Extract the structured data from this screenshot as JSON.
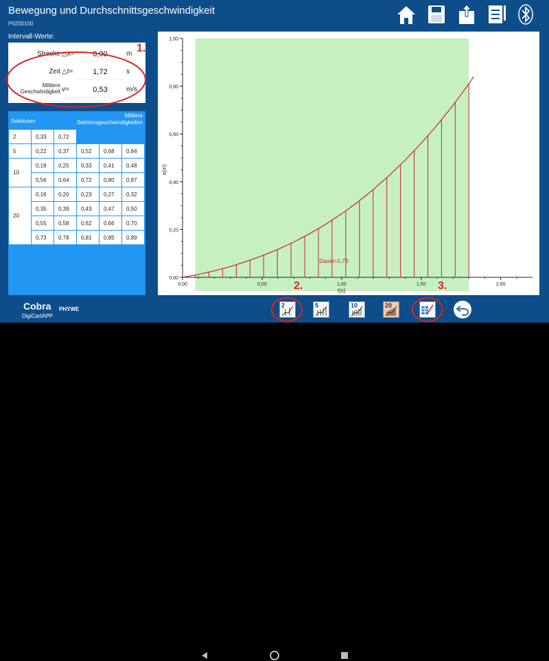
{
  "header": {
    "title": "Bewegung und Durchschnittsgeschwindigkeit",
    "subtitle": "P6200100",
    "icons": [
      "home-icon",
      "save-icon",
      "share-icon",
      "notes-icon",
      "bluetooth-icon"
    ]
  },
  "intervals": {
    "title": "Intervall-Werte:",
    "rows": [
      {
        "label": "Strecke",
        "symbol": "△x=",
        "value": "0,90",
        "unit": "m"
      },
      {
        "label": "Zeit",
        "symbol": "△t=",
        "value": "1,72",
        "unit": "s"
      },
      {
        "label": "Mittlere Geschwindigkeit",
        "symbol": "v=",
        "value": "0,53",
        "unit": "m/s"
      }
    ]
  },
  "sections": {
    "header_left": "Sektionen",
    "header_right_1": "Mittlere",
    "header_right_2": "Sektionsgeschwindigkeiten",
    "groups": [
      {
        "label": "2",
        "rows": [
          [
            "0,33",
            "0,72"
          ]
        ]
      },
      {
        "label": "5",
        "rows": [
          [
            "0,22",
            "0,37",
            "0,52",
            "0,68",
            "0,84"
          ]
        ]
      },
      {
        "label": "10",
        "rows": [
          [
            "0,18",
            "0,25",
            "0,33",
            "0,41",
            "0,48"
          ],
          [
            "0,56",
            "0,64",
            "0,72",
            "0,80",
            "0,87"
          ]
        ]
      },
      {
        "label": "20",
        "rows": [
          [
            "0,16",
            "0,20",
            "0,23",
            "0,27",
            "0,32"
          ],
          [
            "0,35",
            "0,39",
            "0,43",
            "0,47",
            "0,50"
          ],
          [
            "0,55",
            "0,58",
            "0,62",
            "0,66",
            "0,70"
          ],
          [
            "0,73",
            "0,78",
            "0,81",
            "0,85",
            "0,89"
          ]
        ]
      }
    ]
  },
  "chart_data": {
    "type": "line",
    "xlabel": "t(s)",
    "ylabel": "x(m)",
    "xlim": [
      0,
      2.2
    ],
    "ylim": [
      0,
      1.0
    ],
    "xticks": [
      "0,00",
      "0,50",
      "1,00",
      "1,50",
      "2,00"
    ],
    "yticks": [
      "0,00",
      "0,20",
      "0,40",
      "0,60",
      "0,80",
      "1,00"
    ],
    "highlight_range": [
      0.08,
      1.8
    ],
    "highlight_color": "#c6f0c0",
    "curve_color": "#c0262d",
    "annotation": "Dauer=1,73",
    "series": [
      {
        "x": [
          0,
          0.1,
          0.2,
          0.3,
          0.4,
          0.5,
          0.6,
          0.7,
          0.8,
          0.9,
          1.0,
          1.1,
          1.2,
          1.3,
          1.4,
          1.5,
          1.6,
          1.7,
          1.8,
          1.83
        ],
        "y": [
          0.0,
          0.012,
          0.027,
          0.045,
          0.066,
          0.09,
          0.117,
          0.148,
          0.183,
          0.222,
          0.266,
          0.314,
          0.368,
          0.427,
          0.491,
          0.561,
          0.637,
          0.72,
          0.81,
          0.84
        ]
      }
    ],
    "sections": 20
  },
  "toolbar": {
    "buttons": [
      {
        "label": "2",
        "name": "sections-2-button"
      },
      {
        "label": "5",
        "name": "sections-5-button"
      },
      {
        "label": "10",
        "name": "sections-10-button"
      },
      {
        "label": "20",
        "name": "sections-20-button"
      }
    ]
  },
  "logo": {
    "brand": "Cobra",
    "sub": "DigiCartAPP",
    "company": "PHYWE"
  },
  "annotations": [
    "1.",
    "2.",
    "3."
  ]
}
